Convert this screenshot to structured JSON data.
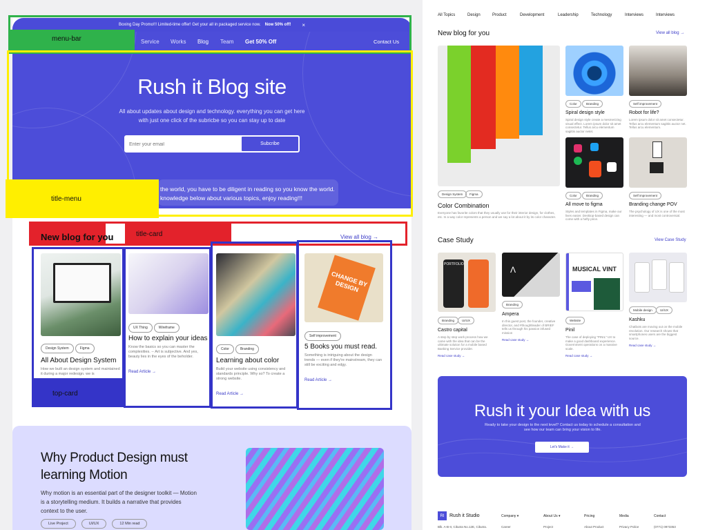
{
  "annotations": {
    "menu_bar": "menu-bar",
    "title_menu": "title-menu",
    "title_card": "title-card",
    "top_card": "top-card"
  },
  "colors": {
    "accent": "#4c4dd9",
    "menu_box": "#2fb24b",
    "title_box": "#ffef00",
    "card_title_box": "#e3222b",
    "card_box": "#3434c8",
    "light_purple": "#dcdcff"
  },
  "left": {
    "promo": {
      "text": "Boxing Day Promo!!! Limited-time offer! Get your all in packaged service now.",
      "bold": "Now 50% off!",
      "close": "×"
    },
    "nav": {
      "service": "Service",
      "works": "Works",
      "blog": "Blog",
      "team": "Team",
      "offer": "Get 50% Off",
      "contact": "Contact Us"
    },
    "hero": {
      "title": "Rush it Blog site",
      "desc": "All about updates about design and technology. everything you can get here with just one click of the subricbe so you can stay up to date",
      "email_placeholder": "Enter your email",
      "subscribe": "Subcribe",
      "note_line1": "the world, you have to be diligent in reading so you know the world.",
      "note_line2": "knowledge below about various topics, enjoy reading!!!"
    },
    "section": {
      "title": "New blog for you",
      "view_all": "View all blog"
    },
    "cards": [
      {
        "tags": [
          "Design System",
          "Figma"
        ],
        "title": "All About Design System",
        "desc": "How we built an design system and maintained it during a major redesign. we is"
      },
      {
        "tags": [
          "UX Thing",
          "Wireframe"
        ],
        "title": "How to explain your ideas",
        "desc": "Know the basics so you can master the complexities. -- Art is subjective. And yes, beauty lies in the eyes of the beholder.",
        "link": "Read Article"
      },
      {
        "tags": [
          "Color",
          "Branding"
        ],
        "title": "Learning about color",
        "desc": "Build your website using consistency and standards principle. Why so? To create a strong website.",
        "link": "Read Article"
      },
      {
        "tags": [
          "Self improvement"
        ],
        "title": "5 Books you must read.",
        "desc": "Something is intriguing about the design trends — even if they're mainstream, they can still be exciting and edgy.",
        "link": "Read Article",
        "book_text": "CHANGE BY DESIGN"
      }
    ],
    "feature": {
      "title_line1": "Why Product Design must",
      "title_line2": "learning Motion",
      "desc": "Why motion is an essential part of the designer toolkit — Motion is a storytelling medium. It builds a narrative that provides context to the user.",
      "tags": [
        "Live Project",
        "UI/UX",
        "12 Min read"
      ]
    }
  },
  "right": {
    "nav": [
      "All Topics",
      "Design",
      "Product",
      "Development",
      "Leadership",
      "Technology",
      "Interviews",
      "Interviews"
    ],
    "blog": {
      "title": "New blog for you",
      "view_all": "View all blog",
      "main": {
        "tags": [
          "Design System",
          "Figma"
        ],
        "title": "Color Combination",
        "desc": "Everyone has favorite colors that they usually use for their interior design, for clothes, etc. In a way color represents a person and we say a lot about it by its color character."
      },
      "items": [
        {
          "tags": [
            "Color",
            "Branding"
          ],
          "title": "Spiral design style",
          "desc": "Spiral design style create a mesmerizing visual effect. Lorem ipsum dolor sit amet consectetur. Tellus arcu elementum sagittis auctor netet."
        },
        {
          "tags": [
            "Self improvement"
          ],
          "title": "Robot for life?",
          "desc": "Lorem ipsum dolor sit amet consectetur. Tellus arcu elementum sagittis auctor net. Tellus arcu elementum."
        },
        {
          "tags": [
            "Color",
            "Branding"
          ],
          "title": "All move to figma",
          "desc": "Styles and templates in Figma, make our lives easier. Desktop-based design can come with a hefty price."
        },
        {
          "tags": [
            "Self improvement"
          ],
          "title": "Branding change POV",
          "desc": "The psychology of UX is one of the most interesting — and most controversial."
        }
      ]
    },
    "case": {
      "title": "Case Study",
      "view_all": "View Case Study",
      "items": [
        {
          "tags": [
            "Branding",
            "UI/UX"
          ],
          "title": "Castro capital",
          "desc": "A step by step work process how we came with the idea that can be the ultimate solution for a mobile based Banking Service provider.",
          "link": "Read case study",
          "img_text": "PORTFOLIO"
        },
        {
          "tags": [
            "Branding"
          ],
          "title": "Ampera",
          "desc": "In this guest post, the founder, creative director, and #thoughtleader of BRIEF tells us through his passion infused mission",
          "link": "Read case study"
        },
        {
          "tags": [
            "Website"
          ],
          "title": "Pinil",
          "desc": "The case of deploying \"PINIL\" UX to make a good dashboard experience. Government operations on a massive scale.",
          "link": "Read case study",
          "img_text": "MUSICAL VINT"
        },
        {
          "tags": [
            "Mobile design",
            "UI/UX"
          ],
          "title": "Kashku",
          "desc": "Chatbots are moving out on the mobile revolution. Our research shows that smartphones users are the biggest source.",
          "link": "Read case study"
        }
      ]
    },
    "cta": {
      "title": "Rush it your Idea with us",
      "desc": "Ready to take your design to the next level? Contact us today to schedule a consultation and see how our team can bring your vision to life.",
      "button": "Let's Make it"
    },
    "footer": {
      "brand": "Rush it Studio",
      "logo": "RI",
      "address": "Blk. A-B-II, Cikutra No.12E, Cikutra.",
      "cols": [
        {
          "title": "Company",
          "sub": "Career"
        },
        {
          "title": "About Us",
          "sub": "Project"
        },
        {
          "title": "Pricing",
          "sub": "About Product"
        },
        {
          "title": "Media",
          "sub": "Privacy Police"
        },
        {
          "title": "Contact",
          "sub": "(0771) 0973353"
        }
      ]
    }
  }
}
